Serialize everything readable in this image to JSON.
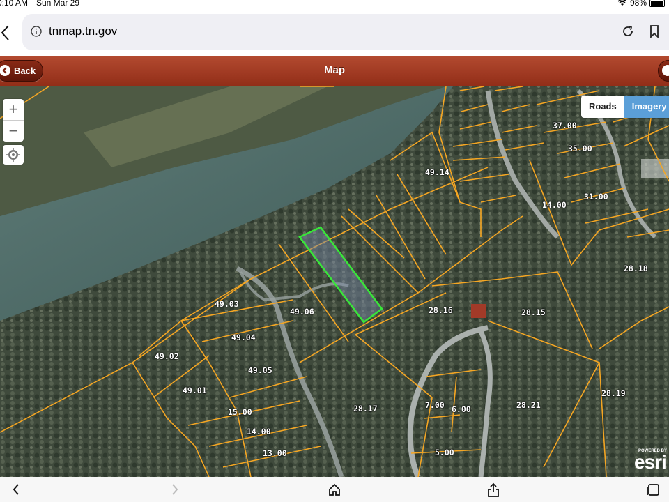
{
  "status_bar": {
    "time": "0:10 AM",
    "date": "Sun Mar 29",
    "battery": "98%",
    "battery_level": 0.98
  },
  "browser": {
    "url": "tnmap.tn.gov"
  },
  "header": {
    "title": "Map",
    "back_label": "Back"
  },
  "basemap": {
    "roads_label": "Roads",
    "imagery_label": "Imagery",
    "selected": "Imagery"
  },
  "attribution": {
    "powered_by": "POWERED BY",
    "logo_text": "esri"
  },
  "colors": {
    "header_red": "#a33a22",
    "parcel_line": "#f5a623",
    "selected_parcel": "#39e639",
    "imagery_active": "#5b9fd8"
  },
  "map_labels": [
    {
      "text": "49.14"
    },
    {
      "text": "37.00"
    },
    {
      "text": "35.00"
    },
    {
      "text": "31.00"
    },
    {
      "text": "14.00"
    },
    {
      "text": "28.18"
    },
    {
      "text": "49.03"
    },
    {
      "text": "49.06"
    },
    {
      "text": "28.16"
    },
    {
      "text": "28.15"
    },
    {
      "text": "49.04"
    },
    {
      "text": "49.02"
    },
    {
      "text": "49.05"
    },
    {
      "text": "49.01"
    },
    {
      "text": "15.00"
    },
    {
      "text": "14.00"
    },
    {
      "text": "13.00"
    },
    {
      "text": "28.17"
    },
    {
      "text": "7.00"
    },
    {
      "text": "6.00"
    },
    {
      "text": "28.21"
    },
    {
      "text": "28.19"
    },
    {
      "text": "5.00"
    }
  ],
  "icons": [
    "info-icon",
    "reload-icon",
    "bookmark-icon",
    "back-chevron-icon",
    "forward-chevron-icon",
    "home-icon",
    "share-icon",
    "tabs-icon",
    "wifi-icon",
    "battery-icon",
    "locate-icon",
    "zoom-in-icon",
    "zoom-out-icon"
  ]
}
